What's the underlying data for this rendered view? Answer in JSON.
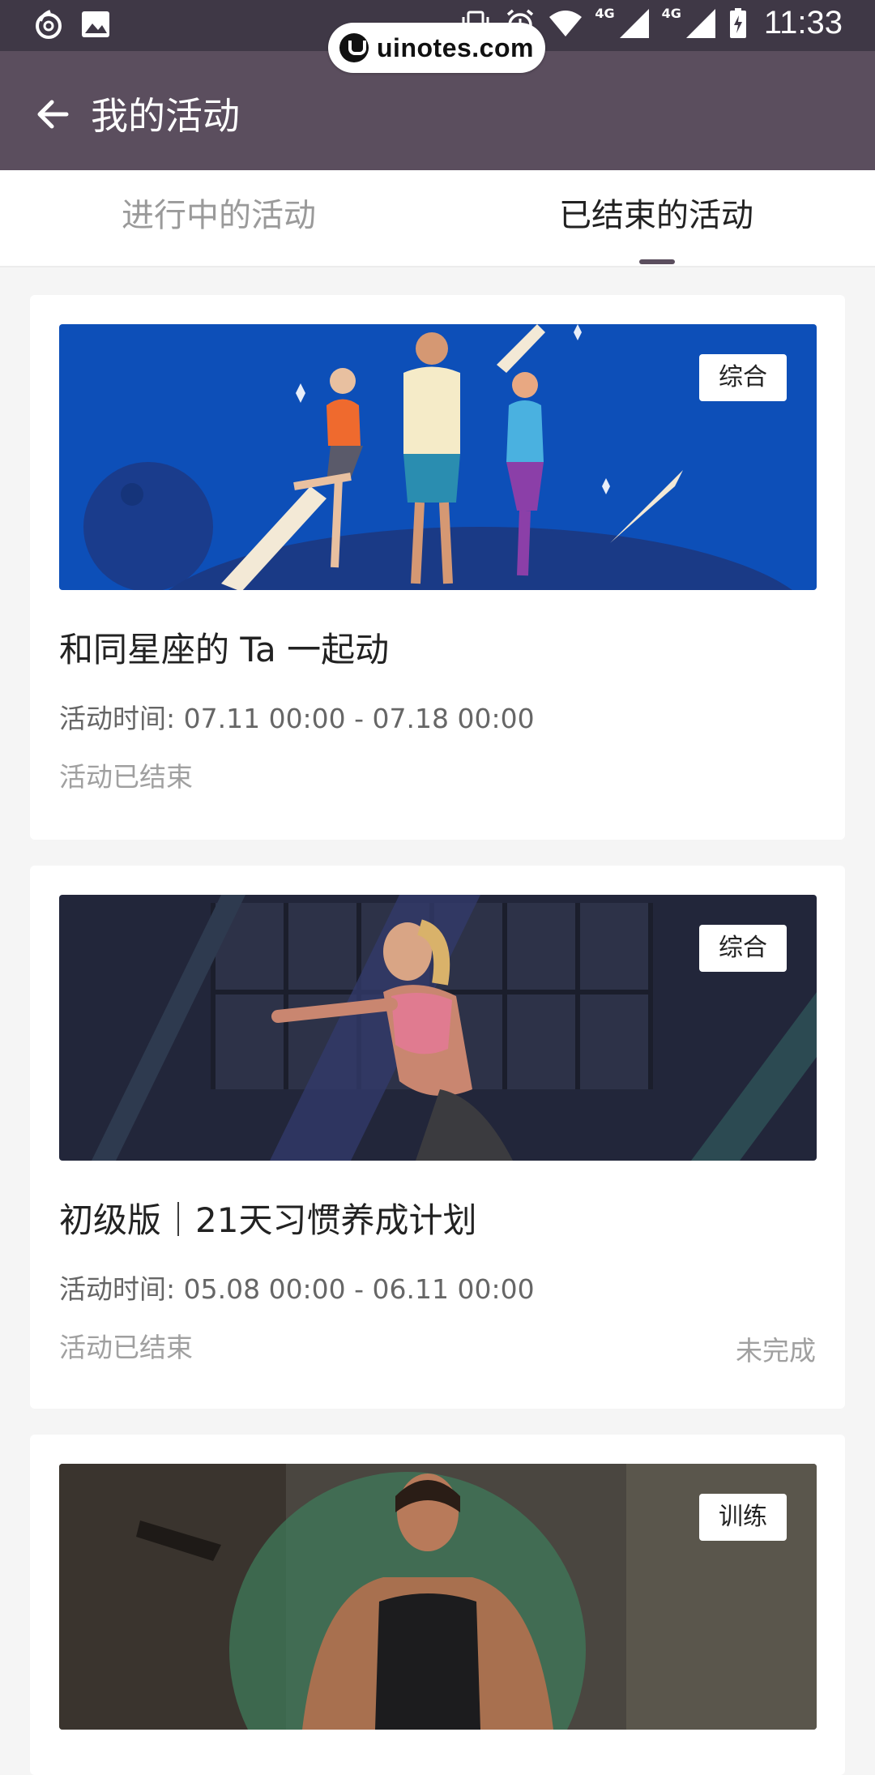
{
  "status_bar": {
    "time": "11:33",
    "network_1": "4G",
    "network_2": "4G",
    "icons": [
      "netease-icon",
      "image-icon",
      "vibrate-icon",
      "alarm-icon",
      "wifi-icon",
      "signal-icon",
      "signal-icon",
      "battery-charging-icon"
    ]
  },
  "watermark": {
    "text": "uinotes.com"
  },
  "app_bar": {
    "title": "我的活动",
    "back_icon": "arrow-left-icon"
  },
  "tabs": [
    {
      "label": "进行中的活动",
      "active": false
    },
    {
      "label": "已结束的活动",
      "active": true
    }
  ],
  "colors": {
    "app_bar": "#5b4e5e",
    "status_bar": "#3f3846",
    "tab_indicator": "#5b4e5e"
  },
  "activities": [
    {
      "tag": "综合",
      "title": "和同星座的 Ta 一起动",
      "time": "活动时间: 07.11 00:00 - 07.18 00:00",
      "status": "活动已结束",
      "result": ""
    },
    {
      "tag": "综合",
      "title": "初级版｜21天习惯养成计划",
      "time": "活动时间: 05.08 00:00 - 06.11 00:00",
      "status": "活动已结束",
      "result": "未完成"
    },
    {
      "tag": "训练",
      "title": "",
      "time": "",
      "status": "",
      "result": ""
    }
  ]
}
